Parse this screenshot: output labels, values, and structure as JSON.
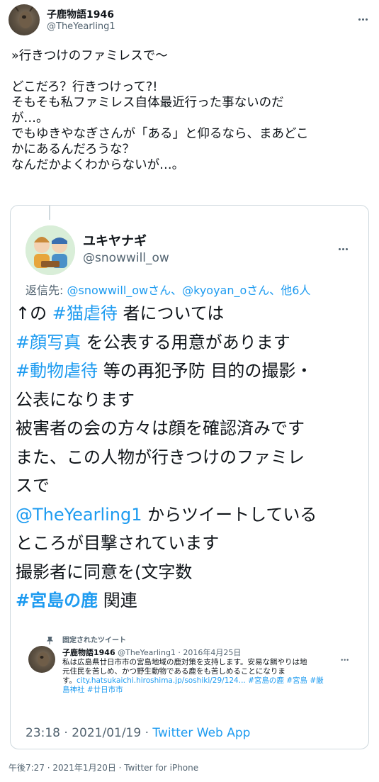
{
  "tweet": {
    "author_name": "子鹿物語1946",
    "author_handle": "@TheYearling1",
    "lines": [
      "»行きつけのファミレスで〜",
      "",
      "どこだろ？行きつけって?!",
      "そもそも私ファミレス自体最近行った事ないのだ",
      "が…。",
      "でもゆきやなぎさんが「ある」と仰るなら、まあどこ",
      "かにあるんだろうな？",
      "なんだかよくわからないが…。"
    ],
    "footer": "午後7:27 · 2021年1月20日 · Twitter for iPhone"
  },
  "quoted": {
    "author_name": "ユキヤナギ",
    "author_handle": "@snowwill_ow",
    "reply_prefix": "返信先: ",
    "reply_mentions": "@snowwill_owさん、@kyoyan_oさん、他6人",
    "body": {
      "l1_pre": "↑の ",
      "l1_tag": "#猫虐待",
      "l1_post": " 者については",
      "l2_tag": "#顔写真",
      "l2_post": " を公表する用意があります",
      "l3_tag": "#動物虐待",
      "l3_post": " 等の再犯予防 目的の撮影・",
      "l4": "公表になります",
      "l5": "被害者の会の方々は顔を確認済みです",
      "l6": "また、この人物が行きつけのファミレ",
      "l7": "スで",
      "l8_mention": "@TheYearling1",
      "l8_post": " からツイートしている",
      "l9": "ところが目撃されています",
      "l10": "撮影者に同意を(文字数",
      "l11_tag": "#宮島の鹿",
      "l11_post": " 関連"
    },
    "pinned": {
      "label": "固定されたツイート",
      "name": "子鹿物語1946",
      "handle_date": "@TheYearling1 · 2016年4月25日",
      "line1": "私は広島県廿日市市の宮島地域の鹿対策を支持します。安易な餌やりは地",
      "line2": "元住民を苦しめ、かつ野生動物である鹿をも苦しめることになりま",
      "line3_pre": "す。",
      "line3_link": "city.hatsukaichi.hiroshima.jp/soshiki/29/124... #宮島の鹿 #宮島 #厳",
      "line4_link": "島神社 #廿日市市"
    },
    "time": "23:18 · 2021/01/19 · ",
    "via": "Twitter Web App"
  }
}
